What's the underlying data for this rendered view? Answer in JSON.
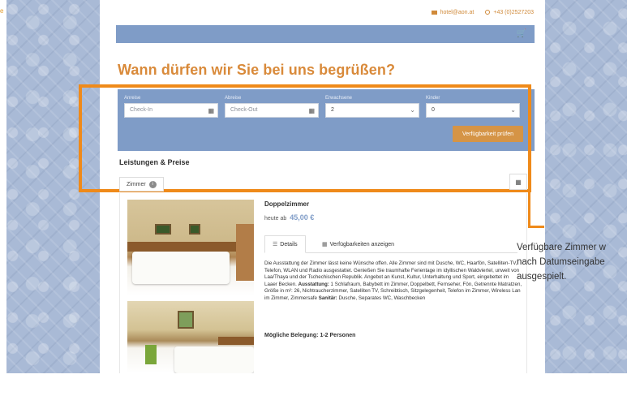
{
  "corner_text": "e",
  "topbar": {
    "email": "hotel@aon.at",
    "phone": "+43 (0)2527203"
  },
  "navbar": {
    "cart_icon": "cart-icon"
  },
  "heading": "Wann dürfen wir Sie bei uns begrüßen?",
  "search": {
    "arrival": {
      "label": "Anreise",
      "placeholder": "Check-In"
    },
    "departure": {
      "label": "Abreise",
      "placeholder": "Check-Out"
    },
    "adults": {
      "label": "Erwachsene",
      "value": "2"
    },
    "children": {
      "label": "Kinder",
      "value": "0"
    },
    "submit_label": "Verfügbarkeit prüfen"
  },
  "section_title": "Leistungen & Preise",
  "filter": {
    "zimmer_label": "Zimmer",
    "info_icon": "i"
  },
  "room": {
    "title": "Doppelzimmer",
    "price_prefix": "heute ab",
    "price": "45,00 €",
    "tabs": [
      "Details",
      "Verfügbarkeiten anzeigen"
    ],
    "description": "Die Ausstattung der Zimmer lässt keine Wünsche offen. Alle Zimmer sind mit Dusche, WC, Haarfön, Satelliten-TV, Telefon, WLAN und Radio ausgestattet. Genießen Sie traumhafte Ferientage im idyllischen Waldviertel, unweit von Laa/Thaya und der Tschechischen Republik. Angebot an Kunst, Kultur, Unterhaltung und Sport, eingebettet im Laaer Becken.",
    "equipment_label": "Ausstattung:",
    "equipment": "1 Schlafraum, Babybett im Zimmer, Doppelbett, Fernseher, Fön, Getrennte Matratzen, Größe in m²: 26, Nichtraucherzimmer, Satelliten TV, Schreibtisch, Sitzgelegenheit, Telefon im Zimmer, Wireless Lan im Zimmer, Zimmersafe",
    "sanitary_label": "Sanitär:",
    "sanitary": "Dusche, Separates WC, Waschbecken",
    "occupancy": "Mögliche Belegung: 1-2 Personen"
  },
  "annotation": {
    "line1": "Verfügbare Zimmer w",
    "line2": "nach Datumseingabe",
    "line3": "ausgespielt."
  },
  "colors": {
    "accent": "#ef8a1a",
    "panel": "#7f9cc7",
    "heading": "#d98a3a",
    "button": "#d59446"
  }
}
